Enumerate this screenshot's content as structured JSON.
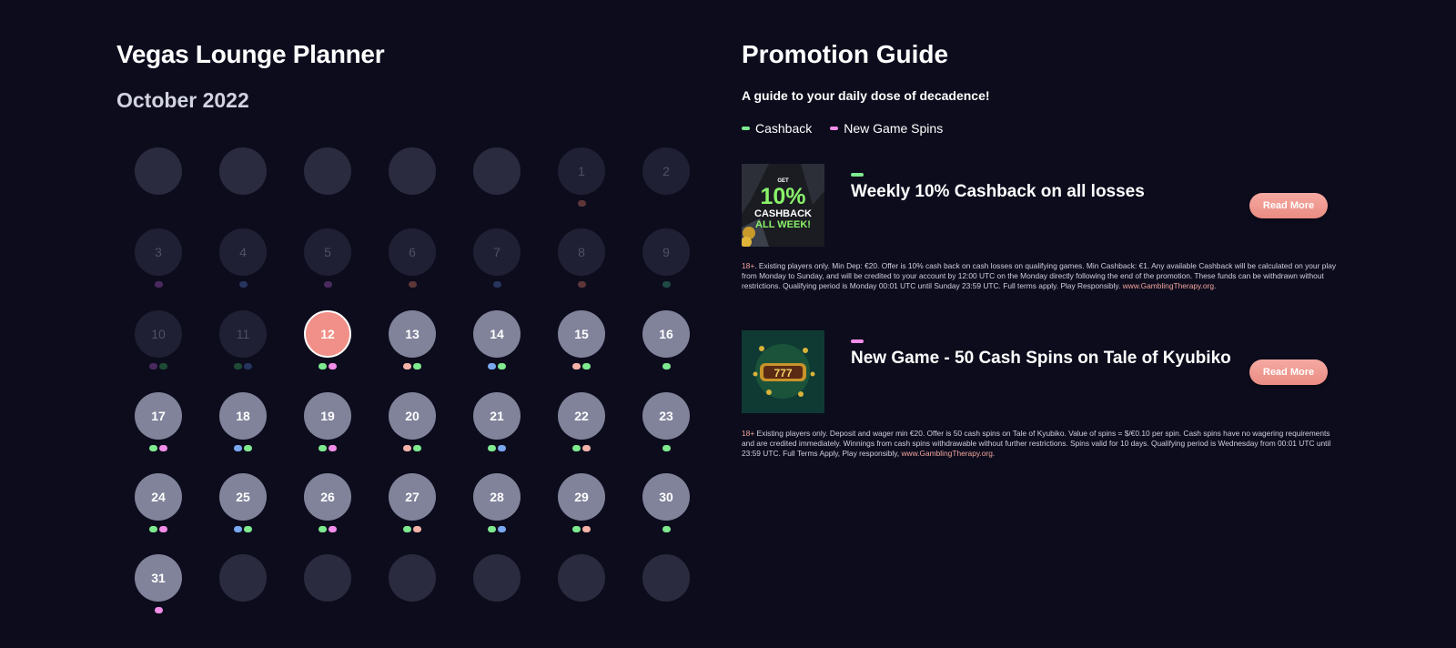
{
  "planner": {
    "title": "Vegas Lounge Planner",
    "month": "October 2022",
    "days": [
      {
        "label": "",
        "state": "empty",
        "dots": []
      },
      {
        "label": "",
        "state": "empty",
        "dots": []
      },
      {
        "label": "",
        "state": "empty",
        "dots": []
      },
      {
        "label": "",
        "state": "empty",
        "dots": []
      },
      {
        "label": "",
        "state": "empty",
        "dots": []
      },
      {
        "label": "1",
        "state": "past",
        "dots": [
          "#5e3638"
        ]
      },
      {
        "label": "2",
        "state": "past",
        "dots": []
      },
      {
        "label": "3",
        "state": "past",
        "dots": [
          "#4a2a5e"
        ]
      },
      {
        "label": "4",
        "state": "past",
        "dots": [
          "#26345e"
        ]
      },
      {
        "label": "5",
        "state": "past",
        "dots": [
          "#4a2a5e"
        ]
      },
      {
        "label": "6",
        "state": "past",
        "dots": [
          "#5e3638"
        ]
      },
      {
        "label": "7",
        "state": "past",
        "dots": [
          "#26345e"
        ]
      },
      {
        "label": "8",
        "state": "past",
        "dots": [
          "#5e3638"
        ]
      },
      {
        "label": "9",
        "state": "past",
        "dots": [
          "#1e4a44"
        ]
      },
      {
        "label": "10",
        "state": "past",
        "dots": [
          "#4a2a5e",
          "#1e4a34"
        ]
      },
      {
        "label": "11",
        "state": "past",
        "dots": [
          "#1e4a34",
          "#26345e"
        ]
      },
      {
        "label": "12",
        "state": "today",
        "dots": [
          "#7ee98e",
          "#f18de8"
        ]
      },
      {
        "label": "13",
        "state": "future",
        "dots": [
          "#f4b2a9",
          "#7ee98e"
        ]
      },
      {
        "label": "14",
        "state": "future",
        "dots": [
          "#79a8f0",
          "#7ee98e"
        ]
      },
      {
        "label": "15",
        "state": "future",
        "dots": [
          "#f4b2a9",
          "#7ee98e"
        ]
      },
      {
        "label": "16",
        "state": "future",
        "dots": [
          "#7ee98e"
        ]
      },
      {
        "label": "17",
        "state": "future",
        "dots": [
          "#7ee98e",
          "#f18de8"
        ]
      },
      {
        "label": "18",
        "state": "future",
        "dots": [
          "#79a8f0",
          "#7ee98e"
        ]
      },
      {
        "label": "19",
        "state": "future",
        "dots": [
          "#7ee98e",
          "#f18de8"
        ]
      },
      {
        "label": "20",
        "state": "future",
        "dots": [
          "#f4b2a9",
          "#7ee98e"
        ]
      },
      {
        "label": "21",
        "state": "future",
        "dots": [
          "#7ee98e",
          "#79a8f0"
        ]
      },
      {
        "label": "22",
        "state": "future",
        "dots": [
          "#7ee98e",
          "#f4b2a9"
        ]
      },
      {
        "label": "23",
        "state": "future",
        "dots": [
          "#7ee98e"
        ]
      },
      {
        "label": "24",
        "state": "future",
        "dots": [
          "#7ee98e",
          "#f18de8"
        ]
      },
      {
        "label": "25",
        "state": "future",
        "dots": [
          "#79a8f0",
          "#7ee98e"
        ]
      },
      {
        "label": "26",
        "state": "future",
        "dots": [
          "#7ee98e",
          "#f18de8"
        ]
      },
      {
        "label": "27",
        "state": "future",
        "dots": [
          "#7ee98e",
          "#f4b2a9"
        ]
      },
      {
        "label": "28",
        "state": "future",
        "dots": [
          "#7ee98e",
          "#79a8f0"
        ]
      },
      {
        "label": "29",
        "state": "future",
        "dots": [
          "#7ee98e",
          "#f4b2a9"
        ]
      },
      {
        "label": "30",
        "state": "future",
        "dots": [
          "#7ee98e"
        ]
      },
      {
        "label": "31",
        "state": "future",
        "dots": [
          "#f18de8"
        ]
      },
      {
        "label": "",
        "state": "empty",
        "dots": []
      },
      {
        "label": "",
        "state": "empty",
        "dots": []
      },
      {
        "label": "",
        "state": "empty",
        "dots": []
      },
      {
        "label": "",
        "state": "empty",
        "dots": []
      },
      {
        "label": "",
        "state": "empty",
        "dots": []
      },
      {
        "label": "",
        "state": "empty",
        "dots": []
      }
    ]
  },
  "guide": {
    "title": "Promotion Guide",
    "subtitle": "A guide to your daily dose of decadence!",
    "legend": [
      {
        "label": "Cashback",
        "color": "#7ee98e"
      },
      {
        "label": "New Game Spins",
        "color": "#f18de8"
      }
    ],
    "promos": [
      {
        "title": "Weekly 10% Cashback on all losses",
        "tag_color": "#7ee98e",
        "button": "Read More",
        "image": {
          "top": "GET",
          "big": "10%",
          "line1": "CASHBACK",
          "line2": "ALL WEEK!"
        },
        "terms_age": "18+",
        "terms_text": ". Existing players only. Min Dep: €20. Offer is 10% cash back on cash losses on qualifying games. Min Cashback: €1. Any available Cashback will be calculated on your play from Monday to Sunday, and will be credited to your account by 12:00 UTC on the Monday directly following the end of the promotion. These funds can be withdrawn without restrictions. Qualifying period is Monday 00:01 UTC until Sunday 23:59 UTC. Full terms apply. Play Responsibly.",
        "terms_link": "www.GamblingTherapy.org",
        "terms_end": "."
      },
      {
        "title": "New Game - 50 Cash Spins on Tale of Kyubiko",
        "tag_color": "#f18de8",
        "button": "Read More",
        "image": {
          "reel": "777"
        },
        "terms_age": "18+",
        "terms_text": " Existing players only. Deposit and wager min €20. Offer is 50 cash spins on Tale of Kyubiko. Value of spins = $/€0.10 per spin. Cash spins have no wagering requirements and are credited immediately. Winnings from cash spins withdrawable without further restrictions. Spins valid for 10 days. Qualifying period is Wednesday from 00:01 UTC until 23:59 UTC. Full Terms Apply, Play responsibly, ",
        "terms_link": "www.GamblingTherapy.org",
        "terms_end": "."
      }
    ]
  }
}
